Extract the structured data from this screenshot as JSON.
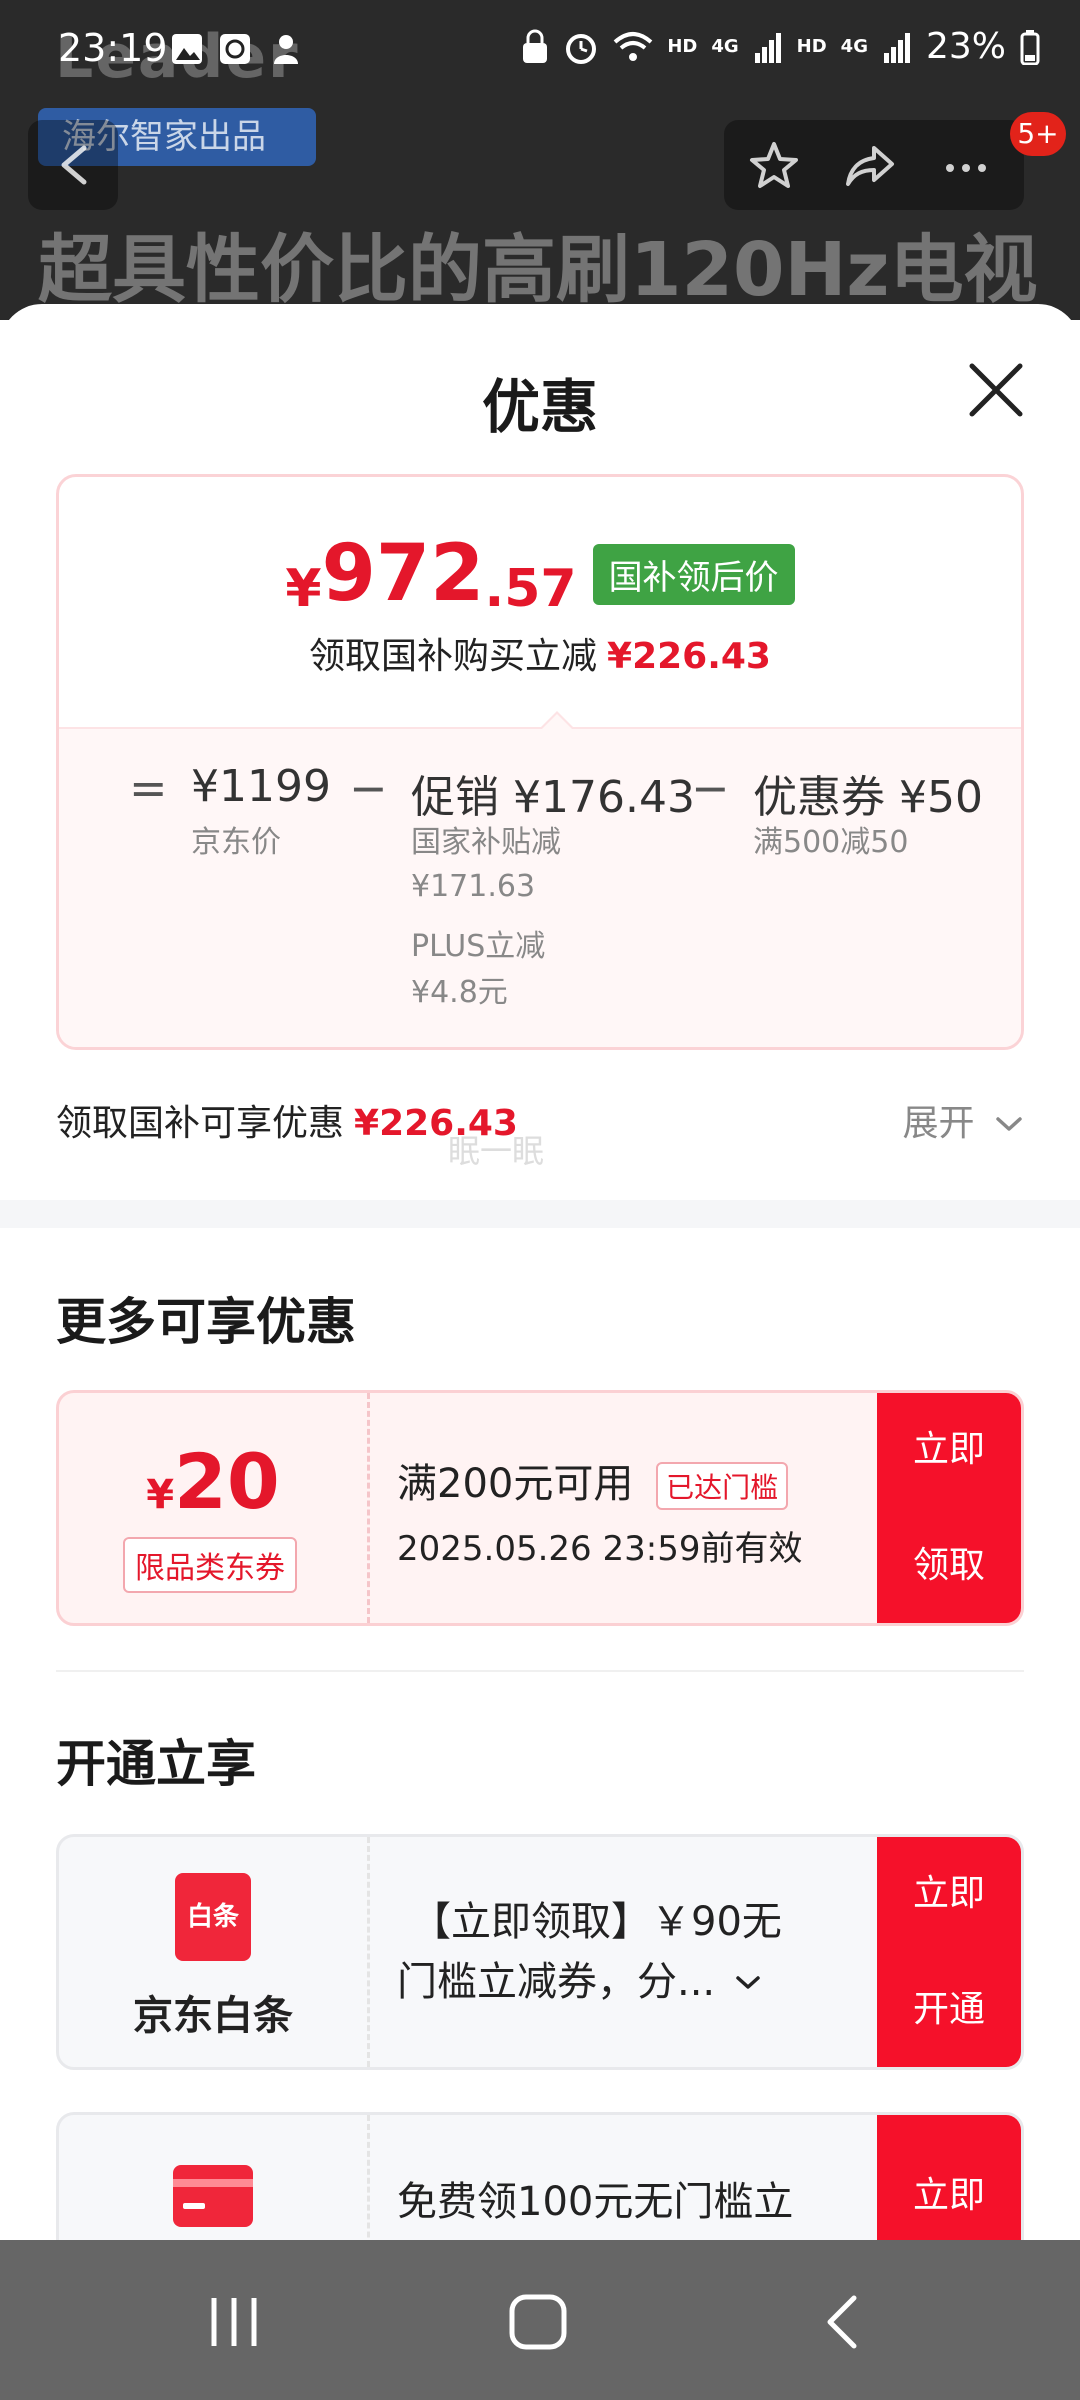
{
  "status_bar": {
    "time": "23:19",
    "hd1": "HD",
    "net1": "4G",
    "hd2": "HD",
    "net2": "4G",
    "battery": "23%"
  },
  "background": {
    "brand_text": "Leader",
    "tag": "海尔智家出品",
    "headline": "超具性价比的高刷120Hz电视",
    "badge": "5+"
  },
  "sheet": {
    "title": "优惠"
  },
  "price_card": {
    "yen": "¥",
    "price_int": "972",
    "price_dec": ".57",
    "gov_badge": "国补领后价",
    "sub_text": "领取国补购买立减",
    "sub_amount": "¥226.43",
    "breakdown": {
      "eq": "=",
      "minus": "−",
      "jd_price": "¥1199",
      "jd_label": "京东价",
      "promo_value": "促销 ¥176.43",
      "promo_lines": [
        "国家补贴减",
        "¥171.63",
        "PLUS立减",
        "¥4.8元"
      ],
      "coupon_value": "优惠券 ¥50",
      "coupon_label": "满500减50"
    }
  },
  "summary": {
    "label": "领取国补可享优惠",
    "amount": "¥226.43",
    "expand": "展开",
    "watermark": "眠一眠"
  },
  "more_offers": {
    "title": "更多可享优惠",
    "coupon": {
      "yen": "¥",
      "amount": "20",
      "type": "限品类东券",
      "condition": "满200元可用",
      "reached": "已达门槛",
      "validity": "2025.05.26 23:59前有效",
      "btn_line1": "立即",
      "btn_line2": "领取"
    }
  },
  "open_offers": {
    "title": "开通立享",
    "baitiao": {
      "icon_text": "白条",
      "name": "京东白条",
      "desc_line1": "【立即领取】￥90无",
      "desc_line2": "门槛立减券，分...",
      "btn_line1": "立即",
      "btn_line2": "开通"
    },
    "card2": {
      "desc_line1": "免费领100元无门槛立",
      "btn_line1": "立即"
    }
  },
  "colors": {
    "accent_red": "#e4172b",
    "button_red": "#f5112a",
    "gov_green": "#3fa344"
  }
}
